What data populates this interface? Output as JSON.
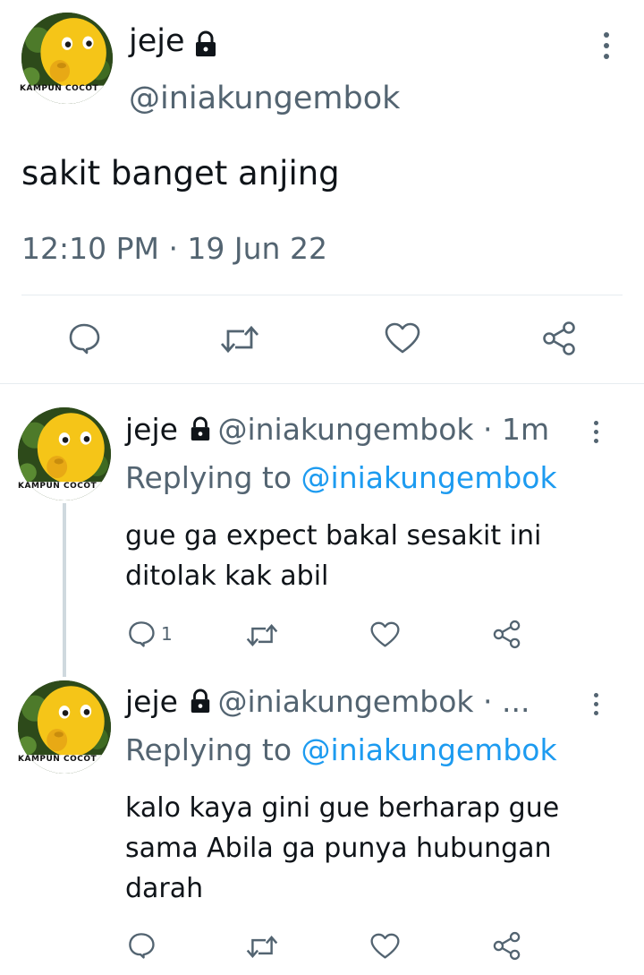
{
  "main_tweet": {
    "display_name": "jeje",
    "handle": "@iniakungembok",
    "avatar_caption": "KAMPUN COCOT",
    "text": "sakit banget anjing",
    "timestamp": "12:10 PM · 19 Jun 22"
  },
  "replies": [
    {
      "display_name": "jeje",
      "meta": "@iniakungembok · 1m",
      "replying_prefix": "Replying to ",
      "replying_handle": "@iniakungembok",
      "avatar_caption": "KAMPUN COCOT",
      "text": "gue ga expect bakal sesakit ini ditolak kak abil",
      "reply_count": "1"
    },
    {
      "display_name": "jeje",
      "meta": "@iniakungembok · ...",
      "replying_prefix": "Replying to ",
      "replying_handle": "@iniakungembok",
      "avatar_caption": "KAMPUN COCOT",
      "text": "kalo kaya gini gue berharap gue sama Abila ga punya hubungan darah",
      "reply_count": ""
    }
  ],
  "icons": {
    "reply": "speech-bubble-icon",
    "retweet": "retweet-icon",
    "like": "heart-icon",
    "share": "share-icon",
    "protected": "lock-icon",
    "more": "more-vertical-icon"
  },
  "colors": {
    "accent": "#1d9bf0",
    "secondary_text": "#536471",
    "primary_text": "#0f1419",
    "divider": "#e6ecf0"
  }
}
